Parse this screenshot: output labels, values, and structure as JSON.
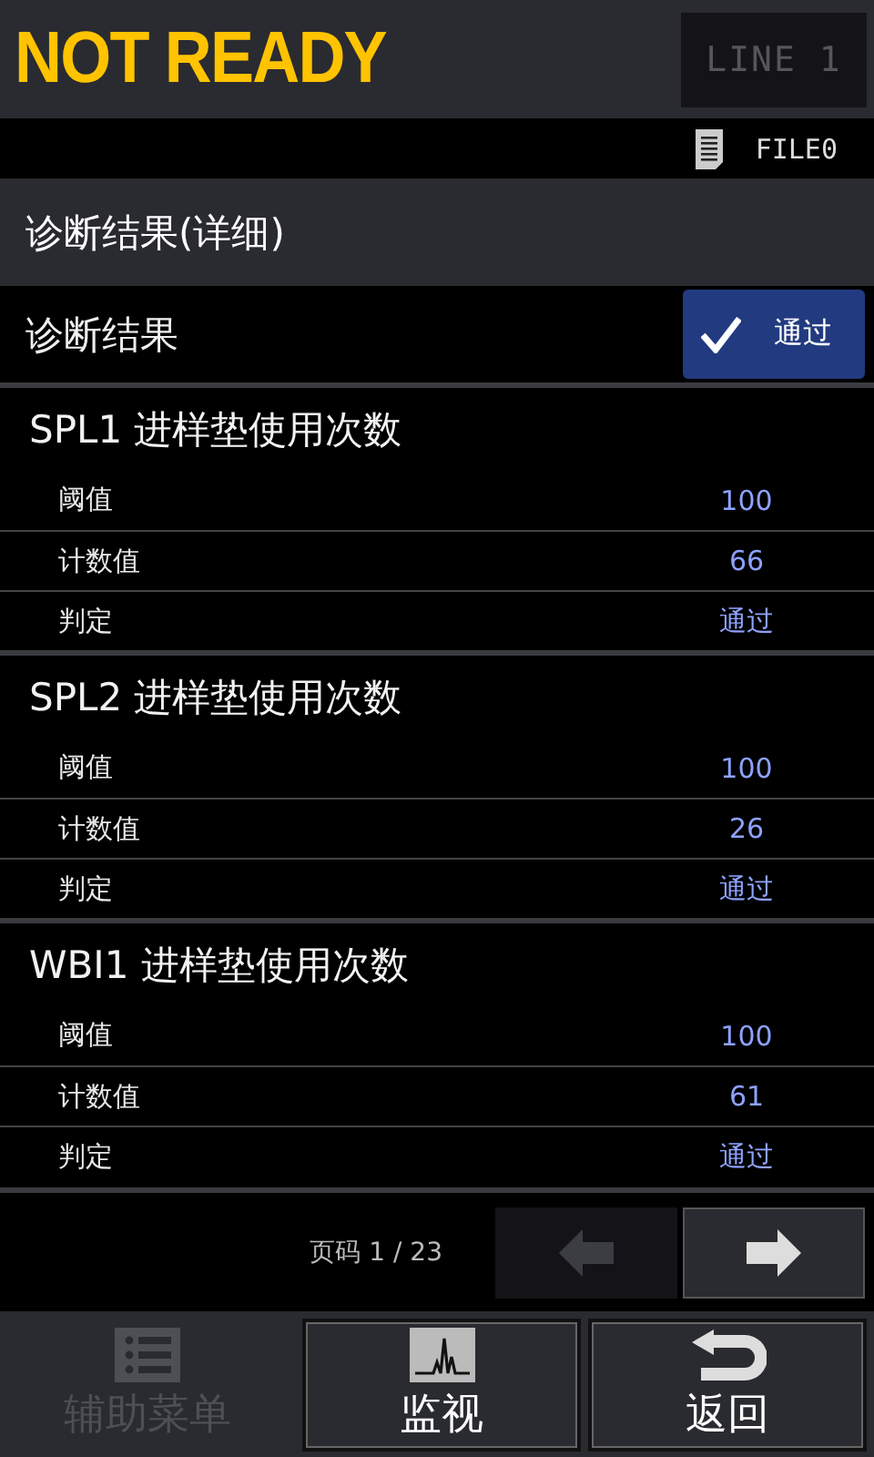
{
  "header": {
    "status": "NOT READY",
    "line_button": {
      "label": "LINE 1",
      "disabled": true
    }
  },
  "file_bar": {
    "file": "FILE0"
  },
  "title": "诊断结果(详细)",
  "result": {
    "label": "诊断结果",
    "badge": "通过",
    "checked": true
  },
  "sections": [
    {
      "title": "SPL1 进样垫使用次数",
      "rows": [
        {
          "label": "阈值",
          "value": "100"
        },
        {
          "label": "计数值",
          "value": "66"
        },
        {
          "label": "判定",
          "value": "通过"
        }
      ]
    },
    {
      "title": "SPL2 进样垫使用次数",
      "rows": [
        {
          "label": "阈值",
          "value": "100"
        },
        {
          "label": "计数值",
          "value": "26"
        },
        {
          "label": "判定",
          "value": "通过"
        }
      ]
    },
    {
      "title": "WBI1 进样垫使用次数",
      "rows": [
        {
          "label": "阈值",
          "value": "100"
        },
        {
          "label": "计数值",
          "value": "61"
        },
        {
          "label": "判定",
          "value": "通过"
        }
      ]
    }
  ],
  "pager": {
    "text": "页码 1 / 23",
    "prev_disabled": true,
    "next_disabled": false
  },
  "nav": [
    {
      "kind": "menu",
      "label": "辅助菜单",
      "disabled": true
    },
    {
      "kind": "monitor",
      "label": "监视",
      "disabled": false
    },
    {
      "kind": "back",
      "label": "返回",
      "disabled": false
    }
  ]
}
